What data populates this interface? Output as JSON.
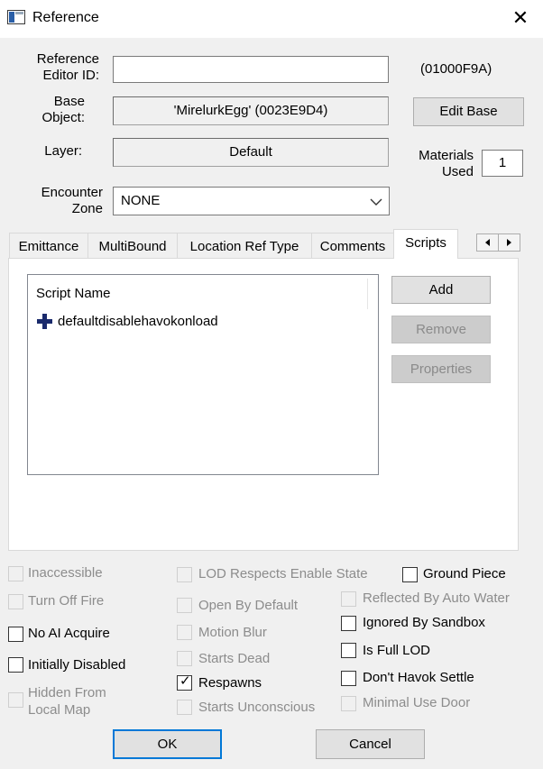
{
  "window": {
    "title": "Reference"
  },
  "fields": {
    "ref_id_label": "Reference\nEditor ID:",
    "ref_id_value": "",
    "form_id": "(01000F9A)",
    "base_label": "Base\nObject:",
    "base_value": "'MirelurkEgg' (0023E9D4)",
    "edit_base": "Edit Base",
    "layer_label": "Layer:",
    "layer_value": "Default",
    "materials_label": "Materials\nUsed",
    "materials_value": "1",
    "encounter_label": "Encounter\nZone",
    "encounter_value": "NONE"
  },
  "tabs": [
    "Emittance",
    "MultiBound",
    "Location Ref Type",
    "Comments",
    "Scripts"
  ],
  "scripts": {
    "column_header": "Script Name",
    "items": [
      "defaultdisablehavokonload"
    ],
    "add": "Add",
    "remove": "Remove",
    "properties": "Properties"
  },
  "checkboxes": {
    "inaccessible": "Inaccessible",
    "turn_off_fire": "Turn Off Fire",
    "no_ai_acquire": "No AI Acquire",
    "initially_disabled": "Initially Disabled",
    "hidden_from_local_map": "Hidden From\nLocal Map",
    "lod_respects": "LOD Respects Enable State",
    "open_by_default": "Open By Default",
    "motion_blur": "Motion Blur",
    "starts_dead": "Starts Dead",
    "respawns": "Respawns",
    "starts_unconscious": "Starts Unconscious",
    "ground_piece": "Ground Piece",
    "reflected_by_auto_water": "Reflected By Auto Water",
    "ignored_by_sandbox": "Ignored By Sandbox",
    "is_full_lod": "Is Full LOD",
    "dont_havok_settle": "Don't Havok Settle",
    "minimal_use_door": "Minimal Use Door"
  },
  "buttons": {
    "ok": "OK",
    "cancel": "Cancel"
  }
}
